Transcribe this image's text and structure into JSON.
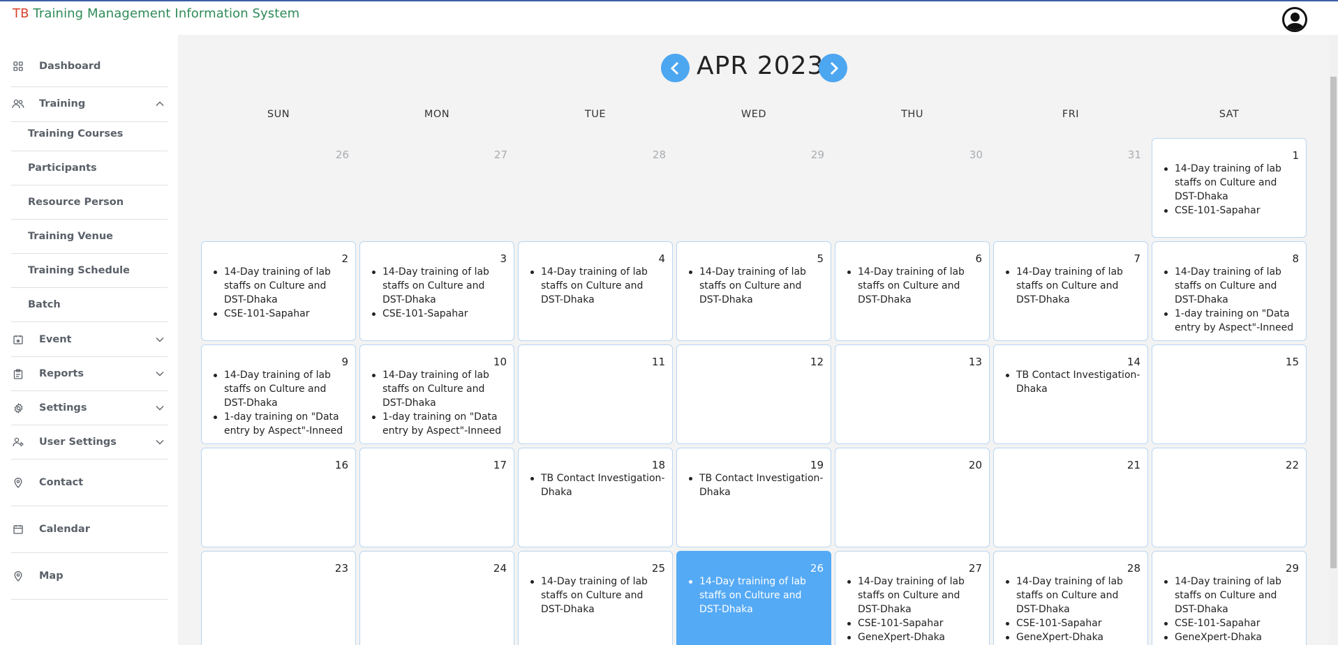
{
  "app": {
    "title_tb": "TB",
    "title_rest": "Training Management Information System",
    "colors": {
      "title_tb": "#d7422b",
      "title_rest": "#2e8b57",
      "accent": "#4da6f0",
      "today": "#55aaf5"
    }
  },
  "sidebar": {
    "dashboard": {
      "label": "Dashboard",
      "icon": "grid-icon"
    },
    "training": {
      "label": "Training",
      "icon": "users-icon",
      "expanded": true,
      "items": [
        "Training Courses",
        "Participants",
        "Resource Person",
        "Training Venue",
        "Training Schedule",
        "Batch"
      ]
    },
    "event": {
      "label": "Event",
      "icon": "calendar-star-icon"
    },
    "reports": {
      "label": "Reports",
      "icon": "clipboard-icon"
    },
    "settings": {
      "label": "Settings",
      "icon": "gear-icon"
    },
    "user_settings": {
      "label": "User Settings",
      "icon": "user-gear-icon"
    },
    "contact": {
      "label": "Contact",
      "icon": "map-pin-icon"
    },
    "calendar": {
      "label": "Calendar",
      "icon": "calendar-icon"
    },
    "map": {
      "label": "Map",
      "icon": "map-pin-icon"
    }
  },
  "calendar": {
    "month_label": "APR 2023",
    "weekdays": [
      "SUN",
      "MON",
      "TUE",
      "WED",
      "THU",
      "FRI",
      "SAT"
    ],
    "today": 26,
    "weeks": [
      [
        {
          "day": "26",
          "muted": true,
          "events": []
        },
        {
          "day": "27",
          "muted": true,
          "events": []
        },
        {
          "day": "28",
          "muted": true,
          "events": []
        },
        {
          "day": "29",
          "muted": true,
          "events": []
        },
        {
          "day": "30",
          "muted": true,
          "events": []
        },
        {
          "day": "31",
          "muted": true,
          "events": []
        },
        {
          "day": "1",
          "events": [
            "14-Day training of lab staffs on Culture and DST-Dhaka",
            "CSE-101-Sapahar"
          ]
        }
      ],
      [
        {
          "day": "2",
          "events": [
            "14-Day training of lab staffs on Culture and DST-Dhaka",
            "CSE-101-Sapahar"
          ]
        },
        {
          "day": "3",
          "events": [
            "14-Day training of lab staffs on Culture and DST-Dhaka",
            "CSE-101-Sapahar"
          ]
        },
        {
          "day": "4",
          "events": [
            "14-Day training of lab staffs on Culture and DST-Dhaka"
          ]
        },
        {
          "day": "5",
          "events": [
            "14-Day training of lab staffs on Culture and DST-Dhaka"
          ]
        },
        {
          "day": "6",
          "events": [
            "14-Day training of lab staffs on Culture and DST-Dhaka"
          ]
        },
        {
          "day": "7",
          "events": [
            "14-Day training of lab staffs on Culture and DST-Dhaka"
          ]
        },
        {
          "day": "8",
          "events": [
            "14-Day training of lab staffs on Culture and DST-Dhaka",
            "1-day training on \"Data entry by Aspect\"-Inneed"
          ]
        }
      ],
      [
        {
          "day": "9",
          "events": [
            "14-Day training of lab staffs on Culture and DST-Dhaka",
            "1-day training on \"Data entry by Aspect\"-Inneed"
          ]
        },
        {
          "day": "10",
          "events": [
            "14-Day training of lab staffs on Culture and DST-Dhaka",
            "1-day training on \"Data entry by Aspect\"-Inneed"
          ]
        },
        {
          "day": "11",
          "events": []
        },
        {
          "day": "12",
          "events": []
        },
        {
          "day": "13",
          "events": []
        },
        {
          "day": "14",
          "events": [
            "TB Contact Investigation-Dhaka"
          ]
        },
        {
          "day": "15",
          "events": []
        }
      ],
      [
        {
          "day": "16",
          "events": []
        },
        {
          "day": "17",
          "events": []
        },
        {
          "day": "18",
          "events": [
            "TB Contact Investigation-Dhaka"
          ]
        },
        {
          "day": "19",
          "events": [
            "TB Contact Investigation-Dhaka"
          ]
        },
        {
          "day": "20",
          "events": []
        },
        {
          "day": "21",
          "events": []
        },
        {
          "day": "22",
          "events": []
        }
      ],
      [
        {
          "day": "23",
          "events": []
        },
        {
          "day": "24",
          "events": []
        },
        {
          "day": "25",
          "events": [
            "14-Day training of lab staffs on Culture and DST-Dhaka"
          ]
        },
        {
          "day": "26",
          "today": true,
          "events": [
            "14-Day training of lab staffs on Culture and DST-Dhaka"
          ]
        },
        {
          "day": "27",
          "events": [
            "14-Day training of lab staffs on Culture and DST-Dhaka",
            "CSE-101-Sapahar",
            "GeneXpert-Dhaka"
          ]
        },
        {
          "day": "28",
          "events": [
            "14-Day training of lab staffs on Culture and DST-Dhaka",
            "CSE-101-Sapahar",
            "GeneXpert-Dhaka"
          ]
        },
        {
          "day": "29",
          "events": [
            "14-Day training of lab staffs on Culture and DST-Dhaka",
            "CSE-101-Sapahar",
            "GeneXpert-Dhaka"
          ]
        }
      ]
    ]
  }
}
